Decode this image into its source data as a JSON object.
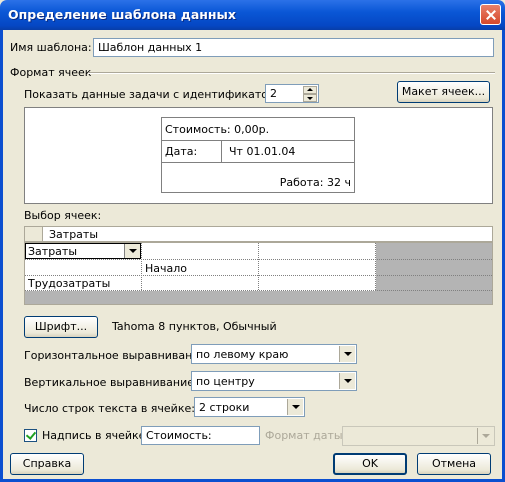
{
  "window": {
    "title": "Определение шаблона данных"
  },
  "template_name": {
    "label": "Имя шаблона:",
    "value": "Шаблон данных 1"
  },
  "cell_format": {
    "group_label": "Формат ячеек",
    "show_task_label": "Показать данные задачи с идентификатором:",
    "task_id": "2",
    "cell_layout_button": "Макет ячеек...",
    "preview": {
      "cost_line": "Стоимость: 0,00р.",
      "date_label": "Дата:",
      "date_value": "Чт 01.01.04",
      "work_line": "Работа: 32 ч"
    }
  },
  "cell_selection": {
    "label": "Выбор ячеек:",
    "edit_value": "Затраты",
    "dropdown_value": "Затраты",
    "row2_col2": "Начало",
    "row3_col1": "Трудозатраты"
  },
  "font": {
    "button": "Шрифт...",
    "description": "Tahoma 8 пунктов, Обычный"
  },
  "h_align": {
    "label": "Горизонтальное выравнивание:",
    "value": "по левому краю"
  },
  "v_align": {
    "label": "Вертикальное выравнивание:",
    "value": "по центру"
  },
  "text_rows": {
    "label": "Число строк текста в ячейке:",
    "value": "2 строки"
  },
  "cell_caption": {
    "checked": true,
    "label": "Надпись в ячейке:",
    "value": "Стоимость:"
  },
  "date_format": {
    "label": "Формат даты:",
    "value": ""
  },
  "buttons": {
    "help": "Справка",
    "ok": "OK",
    "cancel": "Отмена"
  }
}
